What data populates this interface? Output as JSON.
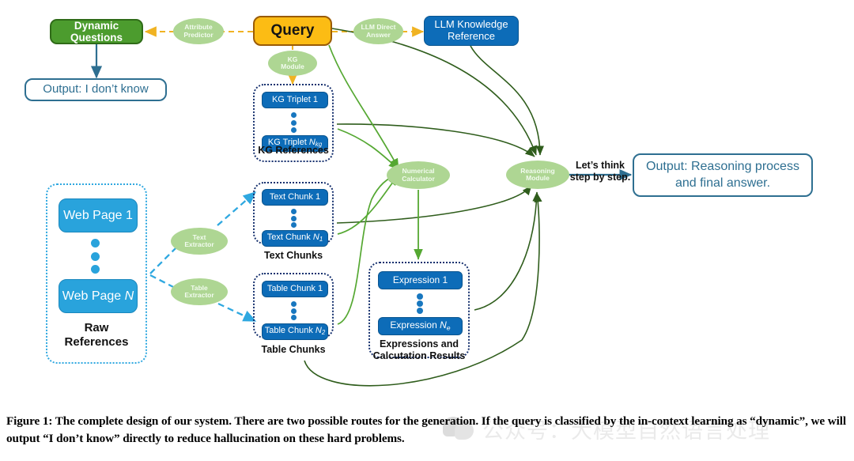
{
  "figure": {
    "caption": "Figure 1: The complete design of our system. There are two possible routes for the generation. If the query is classified by the in-context learning as “dynamic”, we will output “I don’t know” directly to reduce hallucination on these hard problems."
  },
  "watermark": {
    "text": "公众号：大模型自然语言处理"
  },
  "nodes": {
    "dynamic_questions": "Dynamic Questions",
    "output_idk": "Output: I don’t know",
    "query": "Query",
    "llm_knowledge_reference_l1": "LLM Knowledge",
    "llm_knowledge_reference_l2": "Reference",
    "output_reasoning_l1": "Output: Reasoning process",
    "output_reasoning_l2": "and final answer."
  },
  "ellipses": {
    "attribute_predictor_l1": "Attribute",
    "attribute_predictor_l2": "Predictor",
    "llm_direct_answer_l1": "LLM Direct",
    "llm_direct_answer_l2": "Answer",
    "kg_module_l1": "KG",
    "kg_module_l2": "Module",
    "text_extractor_l1": "Text",
    "text_extractor_l2": "Extractor",
    "table_extractor_l1": "Table",
    "table_extractor_l2": "Extractor",
    "numerical_calculator_l1": "Numerical",
    "numerical_calculator_l2": "Calculator",
    "reasoning_module_l1": "Reasoning",
    "reasoning_module_l2": "Module"
  },
  "edge_labels": {
    "lets_think_l1": "Let’s think",
    "lets_think_l2": "step by step."
  },
  "groups": {
    "raw_references": {
      "label_l1": "Raw",
      "label_l2": "References",
      "items": [
        "Web Page 1",
        "Web Page N"
      ]
    },
    "kg_references": {
      "label": "KG References",
      "items": [
        "KG Triplet 1",
        "KG Triplet N"
      ],
      "item2_sub": "kg"
    },
    "text_chunks": {
      "label": "Text Chunks",
      "items": [
        "Text Chunk 1",
        "Text Chunk N"
      ],
      "item2_sub": "1"
    },
    "table_chunks": {
      "label": "Table Chunks",
      "items": [
        "Table Chunk 1",
        "Table Chunk N"
      ],
      "item2_sub": "2"
    },
    "expressions": {
      "label_l1": "Expressions and",
      "label_l2": "Calcutation Results",
      "items": [
        "Expression 1",
        "Expression N"
      ],
      "item2_sub": "e"
    }
  },
  "colors": {
    "green_box": "#4c9c2e",
    "orange_box": "#fcbc14",
    "blue_dark": "#0d6cb8",
    "blue_light": "#29a3dc",
    "outline_blue": "#2e6f91",
    "ellipse_green": "#aed693",
    "arrow_dark_green": "#2f5d1c",
    "arrow_light_green": "#55a832",
    "arrow_orange_dashed": "#f0b323",
    "arrow_cyan_dashed": "#2fa8e0",
    "group_navy": "#16306e",
    "group_cyan": "#2fa8e0"
  }
}
